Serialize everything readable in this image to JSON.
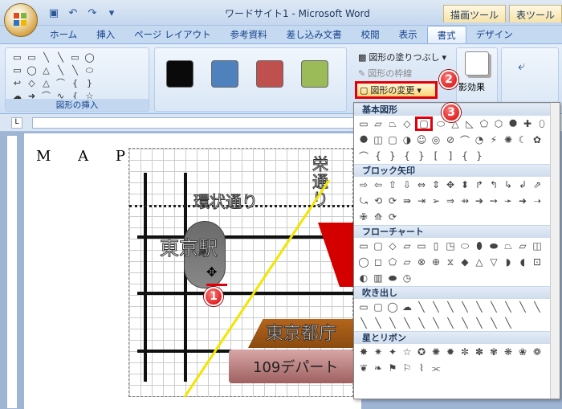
{
  "window": {
    "title": "ワードサイト1 - Microsoft Word",
    "context_tabs": [
      "描画ツール",
      "表ツール"
    ]
  },
  "tabs": [
    "ホーム",
    "挿入",
    "ページ レイアウト",
    "参考資料",
    "差し込み文書",
    "校閲",
    "表示",
    "書式",
    "デザイン"
  ],
  "active_tab": "書式",
  "ribbon": {
    "insert_shapes_label": "図形の挿入",
    "shape_styles": {
      "colors": [
        "#0a0a0a",
        "#4f81bd",
        "#c0504d",
        "#9bbb59"
      ]
    },
    "fill_label": "図形の塗りつぶし",
    "outline_label": "図形の枠線",
    "change_shape_label": "図形の変更",
    "shadow_label": "影効果"
  },
  "document": {
    "heading": "M A P",
    "labels": {
      "ring_road": "環状通り",
      "station": "東京駅",
      "street": "栄通り",
      "city_hall": "東京都庁",
      "dept": "109デパート"
    }
  },
  "gallery": {
    "sections": [
      "基本図形",
      "ブロック矢印",
      "フローチャート",
      "吹き出し",
      "星とリボン"
    ]
  },
  "callouts": [
    "1",
    "2",
    "3"
  ],
  "icons": [
    "office-logo",
    "save-icon",
    "undo-icon",
    "redo-icon",
    "move-cursor-icon"
  ]
}
